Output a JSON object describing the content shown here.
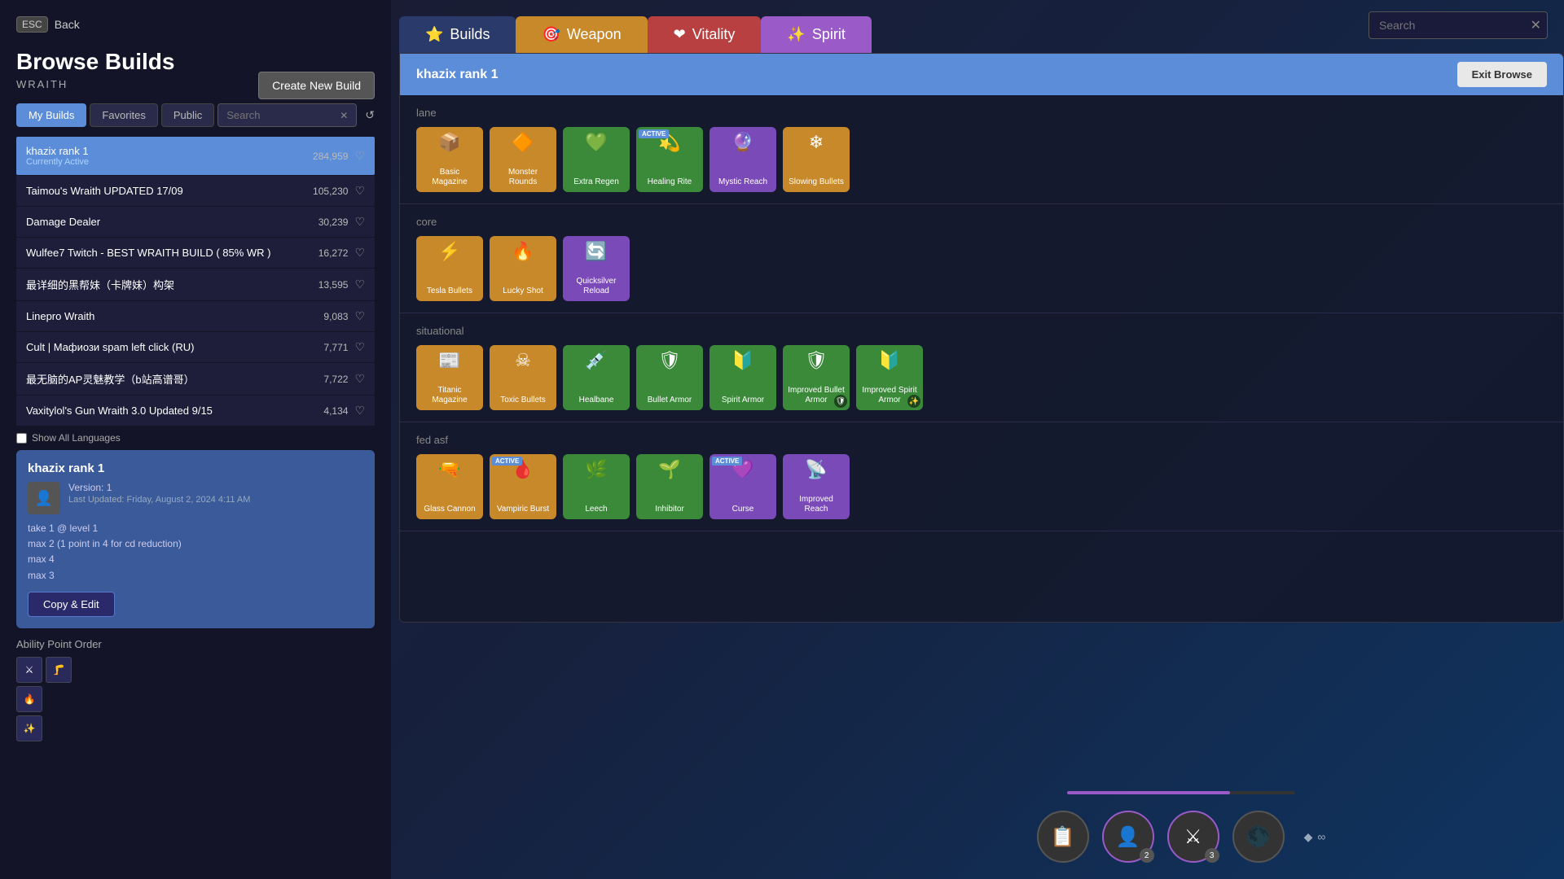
{
  "background": {
    "color": "#1a1a2e"
  },
  "left_panel": {
    "back_btn": {
      "esc_label": "ESC",
      "back_label": "Back"
    },
    "title": "Browse Builds",
    "character": "WRAITH",
    "create_btn_label": "Create New Build",
    "tabs": [
      {
        "id": "my-builds",
        "label": "My Builds",
        "active": true
      },
      {
        "id": "favorites",
        "label": "Favorites",
        "active": false
      },
      {
        "id": "public",
        "label": "Public",
        "active": false
      }
    ],
    "search_placeholder": "Search",
    "show_all_languages_label": "Show All Languages",
    "builds": [
      {
        "name": "khazix rank 1",
        "subtitle": "Currently Active",
        "count": "284,959",
        "selected": true
      },
      {
        "name": "Taimou's Wraith UPDATED 17/09",
        "subtitle": "",
        "count": "105,230",
        "selected": false
      },
      {
        "name": "Damage Dealer",
        "subtitle": "",
        "count": "30,239",
        "selected": false
      },
      {
        "name": "Wulfee7 Twitch - BEST WRAITH BUILD ( 85% WR )",
        "subtitle": "",
        "count": "16,272",
        "selected": false
      },
      {
        "name": "最详细的黑帮妹（卡牌妹）构架",
        "subtitle": "",
        "count": "13,595",
        "selected": false
      },
      {
        "name": "Linepro Wraith",
        "subtitle": "",
        "count": "9,083",
        "selected": false
      },
      {
        "name": "Cult | Мафиози spam left click (RU)",
        "subtitle": "",
        "count": "7,771",
        "selected": false
      },
      {
        "name": "最无脑的AP灵魅教学（b站高谱哥）",
        "subtitle": "",
        "count": "7,722",
        "selected": false
      },
      {
        "name": "Vaxitylol's Gun Wraith 3.0 Updated 9/15",
        "subtitle": "",
        "count": "4,134",
        "selected": false
      }
    ],
    "build_detail": {
      "title": "khazix rank 1",
      "icon": "👤",
      "version": "Version: 1",
      "updated": "Last Updated: Friday, August 2, 2024 4:11 AM",
      "notes": [
        "take 1 @ level 1",
        "max 2 (1 point in 4 for cd reduction)",
        "max 4",
        "max 3"
      ],
      "copy_edit_label": "Copy & Edit"
    },
    "ability_point_order": {
      "title": "Ability Point Order",
      "icons": [
        "⚔",
        "🦵",
        "🔥",
        "✨"
      ]
    }
  },
  "main_content": {
    "tabs": [
      {
        "id": "builds",
        "label": "Builds",
        "active": true,
        "icon": "⭐"
      },
      {
        "id": "weapon",
        "label": "Weapon",
        "active": false,
        "icon": "🎯"
      },
      {
        "id": "vitality",
        "label": "Vitality",
        "active": false,
        "icon": "❤"
      },
      {
        "id": "spirit",
        "label": "Spirit",
        "active": false,
        "icon": "✨"
      }
    ],
    "search_placeholder": "Search",
    "header": {
      "title": "khazix rank 1",
      "exit_browse_label": "Exit Browse"
    },
    "sections": [
      {
        "id": "lane",
        "label": "lane",
        "items": [
          {
            "name": "Basic Magazine",
            "icon": "📦",
            "color": "orange",
            "active": false,
            "shield": false
          },
          {
            "name": "Monster Rounds",
            "icon": "🔶",
            "color": "orange",
            "active": false,
            "shield": false
          },
          {
            "name": "Extra Regen",
            "icon": "💚",
            "color": "green",
            "active": false,
            "shield": false
          },
          {
            "name": "Healing Rite",
            "icon": "💫",
            "color": "green",
            "active": true,
            "shield": false
          },
          {
            "name": "Mystic Reach",
            "icon": "🔮",
            "color": "purple",
            "active": false,
            "shield": false
          },
          {
            "name": "Slowing Bullets",
            "icon": "❄",
            "color": "orange",
            "active": false,
            "shield": false
          }
        ]
      },
      {
        "id": "core",
        "label": "core",
        "items": [
          {
            "name": "Tesla Bullets",
            "icon": "⚡",
            "color": "orange",
            "active": false,
            "shield": false
          },
          {
            "name": "Lucky Shot",
            "icon": "🔥",
            "color": "orange",
            "active": false,
            "shield": false
          },
          {
            "name": "Quicksilver Reload",
            "icon": "🔄",
            "color": "purple",
            "active": false,
            "shield": false
          }
        ]
      },
      {
        "id": "situational",
        "label": "situational",
        "items": [
          {
            "name": "Titanic Magazine",
            "icon": "📰",
            "color": "orange",
            "active": false,
            "shield": false
          },
          {
            "name": "Toxic Bullets",
            "icon": "☠",
            "color": "orange",
            "active": false,
            "shield": false
          },
          {
            "name": "Healbane",
            "icon": "💉",
            "color": "green",
            "active": false,
            "shield": false
          },
          {
            "name": "Bullet Armor",
            "icon": "🛡",
            "color": "green",
            "active": false,
            "shield": false
          },
          {
            "name": "Spirit Armor",
            "icon": "🔰",
            "color": "green",
            "active": false,
            "shield": false
          },
          {
            "name": "Improved Bullet Armor",
            "icon": "🛡",
            "color": "green",
            "active": false,
            "shield": true
          },
          {
            "name": "Improved Spirit Armor",
            "icon": "🔰",
            "color": "green",
            "active": false,
            "shield": true
          }
        ]
      },
      {
        "id": "fed-asf",
        "label": "fed asf",
        "items": [
          {
            "name": "Glass Cannon",
            "icon": "🔫",
            "color": "orange",
            "active": false,
            "shield": false
          },
          {
            "name": "Vampiric Burst",
            "icon": "🩸",
            "color": "orange",
            "active": true,
            "shield": false
          },
          {
            "name": "Leech",
            "icon": "🌿",
            "color": "green",
            "active": false,
            "shield": false
          },
          {
            "name": "Inhibitor",
            "icon": "🌱",
            "color": "green",
            "active": false,
            "shield": false
          },
          {
            "name": "Curse",
            "icon": "💜",
            "color": "purple",
            "active": true,
            "shield": false
          },
          {
            "name": "Improved Reach",
            "icon": "📡",
            "color": "purple",
            "active": false,
            "shield": false
          }
        ]
      }
    ],
    "bottom_icons": [
      {
        "icon": "📋",
        "badge": null
      },
      {
        "icon": "👤",
        "badge": "2"
      },
      {
        "icon": "⚔",
        "badge": "3"
      },
      {
        "icon": "🌑",
        "badge": null
      }
    ]
  }
}
